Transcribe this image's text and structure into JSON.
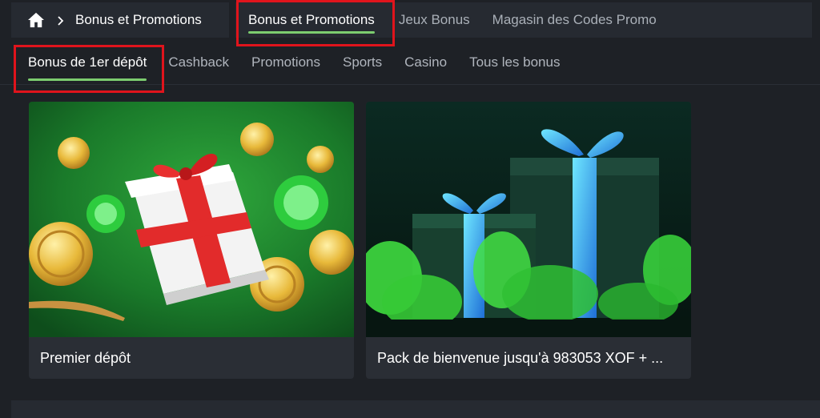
{
  "breadcrumb": {
    "home_icon": "home-icon",
    "separator_icon": "chevron-right-icon",
    "label": "Bonus et Promotions"
  },
  "top_tabs": [
    {
      "label": "Bonus et Promotions",
      "active": true
    },
    {
      "label": "Jeux Bonus",
      "active": false
    },
    {
      "label": "Magasin des Codes Promo",
      "active": false
    }
  ],
  "sub_tabs": [
    {
      "label": "Bonus de 1er dépôt",
      "active": true
    },
    {
      "label": "Cashback",
      "active": false
    },
    {
      "label": "Promotions",
      "active": false
    },
    {
      "label": "Sports",
      "active": false
    },
    {
      "label": "Casino",
      "active": false
    },
    {
      "label": "Tous les bonus",
      "active": false
    }
  ],
  "cards": [
    {
      "title": "Premier dépôt"
    },
    {
      "title": "Pack de bienvenue jusqu'à 983053 XOF + ..."
    }
  ],
  "colors": {
    "background": "#1e2126",
    "nav_bg": "#262a31",
    "active_underline": "#7ccd6f",
    "highlight_box": "#e0141c",
    "card_bg": "#2a2e35"
  }
}
